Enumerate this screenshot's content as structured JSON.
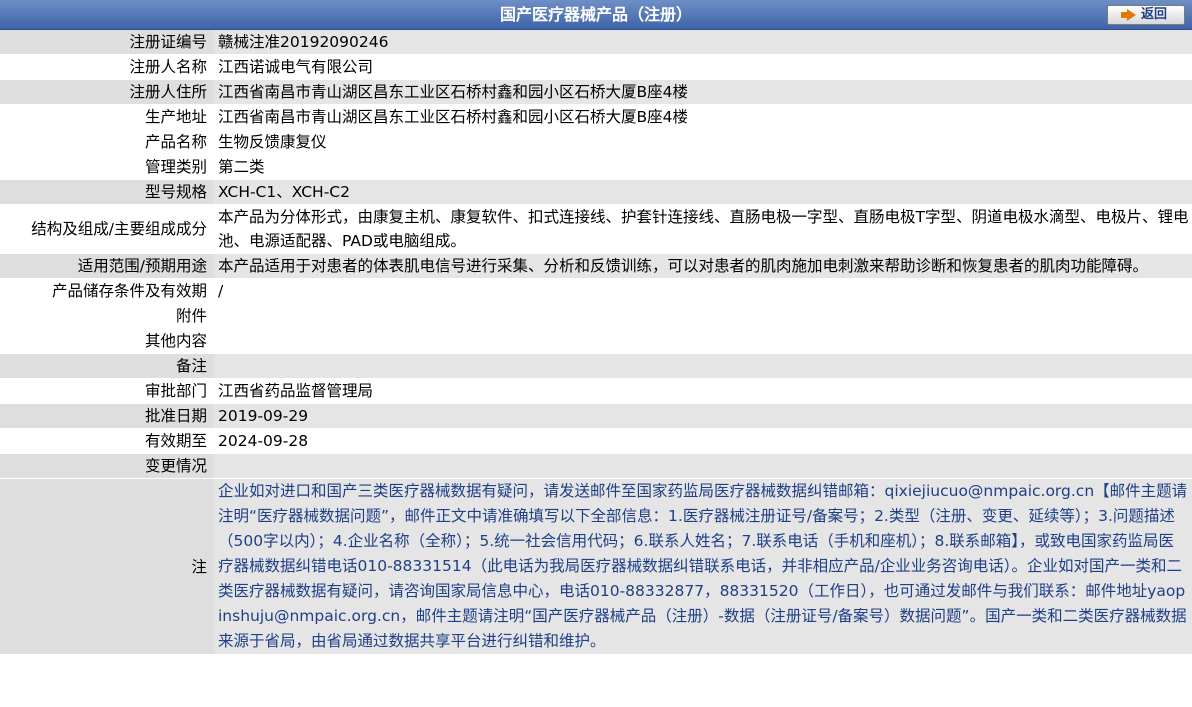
{
  "header": {
    "title": "国产医疗器械产品（注册）",
    "back_label": "返回"
  },
  "rows": [
    {
      "label": "注册证编号",
      "value": "赣械注准20192090246"
    },
    {
      "label": "注册人名称",
      "value": "江西诺诚电气有限公司"
    },
    {
      "label": "注册人住所",
      "value": "江西省南昌市青山湖区昌东工业区石桥村鑫和园小区石桥大厦B座4楼"
    },
    {
      "label": "生产地址",
      "value": "江西省南昌市青山湖区昌东工业区石桥村鑫和园小区石桥大厦B座4楼"
    },
    {
      "label": "产品名称",
      "value": "生物反馈康复仪"
    },
    {
      "label": "管理类别",
      "value": "第二类"
    },
    {
      "label": "型号规格",
      "value": "XCH-C1、XCH-C2"
    },
    {
      "label": "结构及组成/主要组成成分",
      "value": "本产品为分体形式，由康复主机、康复软件、扣式连接线、护套针连接线、直肠电极一字型、直肠电极T字型、阴道电极水滴型、电极片、锂电池、电源适配器、PAD或电脑组成。"
    },
    {
      "label": "适用范围/预期用途",
      "value": "本产品适用于对患者的体表肌电信号进行采集、分析和反馈训练，可以对患者的肌肉施加电刺激来帮助诊断和恢复患者的肌肉功能障碍。"
    },
    {
      "label": "产品储存条件及有效期",
      "value": "/"
    },
    {
      "label": "附件",
      "value": ""
    },
    {
      "label": "其他内容",
      "value": ""
    },
    {
      "label": "备注",
      "value": ""
    },
    {
      "label": "审批部门",
      "value": "江西省药品监督管理局"
    },
    {
      "label": "批准日期",
      "value": "2019-09-29"
    },
    {
      "label": "有效期至",
      "value": "2024-09-28"
    },
    {
      "label": "变更情况",
      "value": ""
    }
  ],
  "note": {
    "label": "注",
    "text": "企业如对进口和国产三类医疗器械数据有疑问，请发送邮件至国家药监局医疗器械数据纠错邮箱：qixiejiucuo@nmpaic.org.cn【邮件主题请注明“医疗器械数据问题”，邮件正文中请准确填写以下全部信息：1.医疗器械注册证号/备案号；2.类型（注册、变更、延续等）；3.问题描述（500字以内）；4.企业名称（全称）；5.统一社会信用代码；6.联系人姓名；7.联系电话（手机和座机）；8.联系邮箱】，或致电国家药监局医疗器械数据纠错电话010-88331514（此电话为我局医疗器械数据纠错联系电话，并非相应产品/企业业务咨询电话）。企业如对国产一类和二类医疗器械数据有疑问，请咨询国家局信息中心，电话010-88332877，88331520（工作日），也可通过发邮件与我们联系：邮件地址yaopinshuju@nmpaic.org.cn，邮件主题请注明“国产医疗器械产品（注册）-数据（注册证号/备案号）数据问题”。国产一类和二类医疗器械数据来源于省局，由省局通过数据共享平台进行纠错和维护。"
  }
}
